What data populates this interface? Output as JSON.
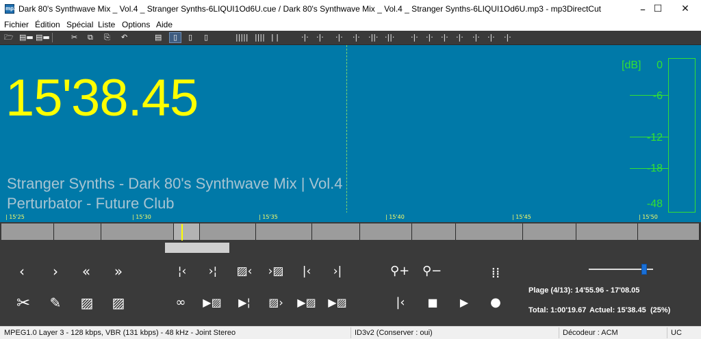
{
  "window": {
    "title": "Dark 80's Synthwave Mix _ Vol.4 _ Stranger Synths-6LIQUI1Od6U.cue / Dark 80's Synthwave Mix _ Vol.4 _ Stranger Synths-6LIQUI1Od6U.mp3 - mp3DirectCut",
    "minimize": "–",
    "maximize": "☐",
    "close": "✕"
  },
  "menu": [
    "Fichier",
    "Édition",
    "Spécial",
    "Liste",
    "Options",
    "Aide"
  ],
  "display": {
    "timecode": "15'38.45",
    "track_title": "Stranger Synths - Dark 80's Synthwave Mix | Vol.4",
    "track_artist": "Perturbator - Future Club",
    "db_unit": "[dB]",
    "db_scale": [
      "0",
      "-6",
      "-12",
      "-18",
      "-48"
    ],
    "colors": {
      "background": "#0079a8",
      "timecode": "#ffff00",
      "meter": "#33e033"
    }
  },
  "ruler": [
    "15'25",
    "15'30",
    "15'35",
    "15'40",
    "15'45",
    "15'50"
  ],
  "info": {
    "range": "Plage (4/13): 14'55.96 - 17'08.05",
    "total": "Total: 1:00'19.67",
    "current": "Actuel: 15'38.45",
    "percent": "(25%)"
  },
  "volume_level": 0.9,
  "status": {
    "format": "MPEG1.0 Layer 3 - 128 kbps, VBR (131 kbps) - 48 kHz - Joint Stereo",
    "tag": "ID3v2 (Conserver : oui)",
    "decoder": "Décodeur : ACM",
    "mode": "UC"
  }
}
